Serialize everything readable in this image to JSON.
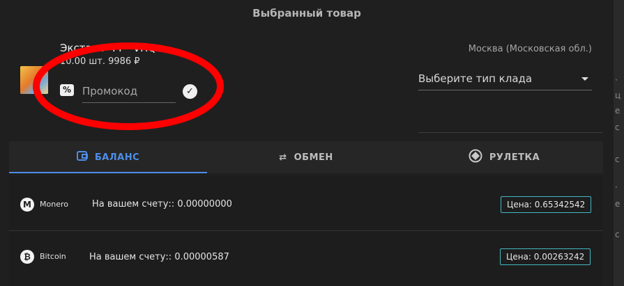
{
  "header": {
    "title": "Выбранный товар"
  },
  "product": {
    "name": "Экстази \"PP\" VHQ",
    "quantity_price": "10.00 шт. 9986 ₽",
    "promo_placeholder": "Промокод"
  },
  "location": {
    "city": "Москва (Московская обл.)",
    "delivery_placeholder": "Выберите тип клада"
  },
  "tabs": [
    {
      "label": "БАЛАНС",
      "icon": "wallet-icon",
      "active": true
    },
    {
      "label": "ОБМЕН",
      "icon": "exchange-arrows-icon",
      "active": false
    },
    {
      "label": "РУЛЕТКА",
      "icon": "roulette-wheel-icon",
      "active": false
    }
  ],
  "wallets": [
    {
      "coin": "Monero",
      "icon": "monero-icon",
      "balance": "На вашем счету:: 0.00000000",
      "price": "Цена: 0.65342542"
    },
    {
      "coin": "Bitcoin",
      "icon": "bitcoin-icon",
      "balance": "На вашем счету:: 0.00000587",
      "price": "Цена: 0.00263242"
    }
  ],
  "colors": {
    "background": "#1f1f1f",
    "accent": "#4d8ee8",
    "price_border": "#44b8c5",
    "annotation": "#ff0000"
  },
  "annotation": {
    "shape": "red-ellipse",
    "target": "promo-code-field"
  }
}
